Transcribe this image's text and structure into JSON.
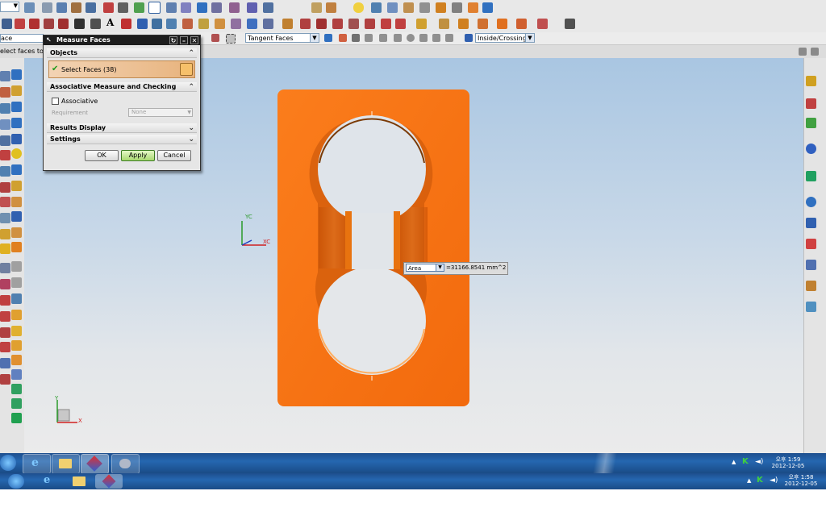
{
  "toolbar": {
    "face_filter": "Tangent Faces",
    "selection_mode": "Inside/Crossing",
    "prompt_left": "ace",
    "status_prompt": "elect faces to"
  },
  "dialog": {
    "title": "Measure Faces",
    "sections": {
      "objects": "Objects",
      "associative": "Associative Measure and Checking",
      "results": "Results Display",
      "settings": "Settings"
    },
    "select_faces": "Select Faces (38)",
    "associative_label": "Associative",
    "requirement_label": "Requirement",
    "requirement_value": "None",
    "buttons": {
      "ok": "OK",
      "apply": "Apply",
      "cancel": "Cancel"
    }
  },
  "measurement": {
    "type": "Area",
    "value": "=31166.8541 mm^2"
  },
  "triad": {
    "yc": "YC",
    "xc": "XC",
    "y": "Y",
    "x": "X"
  },
  "colors": {
    "part_orange": "#f97515",
    "dialog_title_bg": "#1e1e1e",
    "taskbar_blue": "#2567b0"
  },
  "taskbar_top": {
    "ampm": "오후",
    "time": "1:59",
    "date": "2012-12-05"
  },
  "taskbar_bottom": {
    "ampm": "오후",
    "time": "1:58",
    "date": "2012-12-05"
  }
}
